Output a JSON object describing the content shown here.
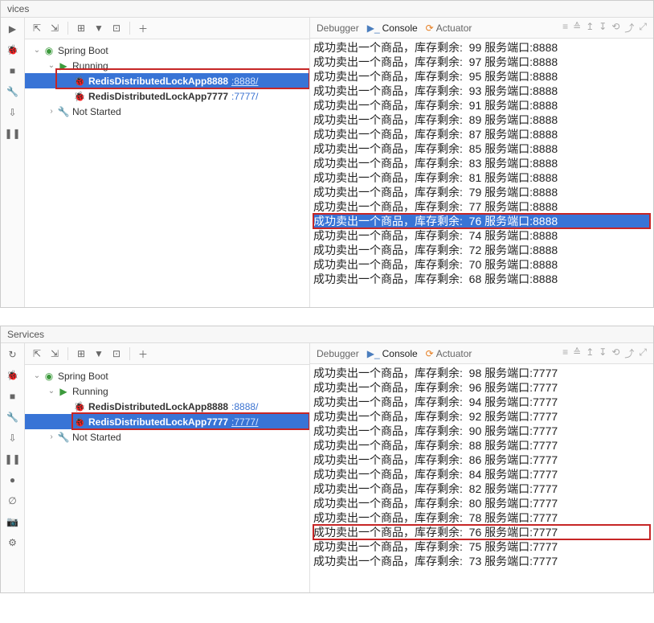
{
  "panel1": {
    "title": "vices",
    "tree": {
      "root": "Spring Boot",
      "running": "Running",
      "app1": {
        "name": "RedisDistributedLockApp8888",
        "port": ":8888/"
      },
      "app2": {
        "name": "RedisDistributedLockApp7777",
        "port": ":7777/"
      },
      "notStarted": "Not Started"
    },
    "tabs": {
      "debugger": "Debugger",
      "console": "Console",
      "actuator": "Actuator"
    },
    "console": [
      "成功卖出一个商品，库存剩余:  99 服务端口:8888",
      "成功卖出一个商品，库存剩余:  97 服务端口:8888",
      "成功卖出一个商品，库存剩余:  95 服务端口:8888",
      "成功卖出一个商品，库存剩余:  93 服务端口:8888",
      "成功卖出一个商品，库存剩余:  91 服务端口:8888",
      "成功卖出一个商品，库存剩余:  89 服务端口:8888",
      "成功卖出一个商品，库存剩余:  87 服务端口:8888",
      "成功卖出一个商品，库存剩余:  85 服务端口:8888",
      "成功卖出一个商品，库存剩余:  83 服务端口:8888",
      "成功卖出一个商品，库存剩余:  81 服务端口:8888",
      "成功卖出一个商品，库存剩余:  79 服务端口:8888",
      "成功卖出一个商品，库存剩余:  77 服务端口:8888",
      "成功卖出一个商品，库存剩余:  76 服务端口:8888",
      "成功卖出一个商品，库存剩余:  74 服务端口:8888",
      "成功卖出一个商品，库存剩余:  72 服务端口:8888",
      "成功卖出一个商品，库存剩余:  70 服务端口:8888",
      "成功卖出一个商品，库存剩余:  68 服务端口:8888"
    ]
  },
  "panel2": {
    "title": "Services",
    "tree": {
      "root": "Spring Boot",
      "running": "Running",
      "app1": {
        "name": "RedisDistributedLockApp8888",
        "port": ":8888/"
      },
      "app2": {
        "name": "RedisDistributedLockApp7777",
        "port": ":7777/"
      },
      "notStarted": "Not Started"
    },
    "tabs": {
      "debugger": "Debugger",
      "console": "Console",
      "actuator": "Actuator"
    },
    "console": [
      "成功卖出一个商品，库存剩余:  98 服务端口:7777",
      "成功卖出一个商品，库存剩余:  96 服务端口:7777",
      "成功卖出一个商品，库存剩余:  94 服务端口:7777",
      "成功卖出一个商品，库存剩余:  92 服务端口:7777",
      "成功卖出一个商品，库存剩余:  90 服务端口:7777",
      "成功卖出一个商品，库存剩余:  88 服务端口:7777",
      "成功卖出一个商品，库存剩余:  86 服务端口:7777",
      "成功卖出一个商品，库存剩余:  84 服务端口:7777",
      "成功卖出一个商品，库存剩余:  82 服务端口:7777",
      "成功卖出一个商品，库存剩余:  80 服务端口:7777",
      "成功卖出一个商品，库存剩余:  78 服务端口:7777",
      "成功卖出一个商品，库存剩余:  76 服务端口:7777",
      "成功卖出一个商品，库存剩余:  75 服务端口:7777",
      "成功卖出一个商品，库存剩余:  73 服务端口:7777"
    ]
  }
}
